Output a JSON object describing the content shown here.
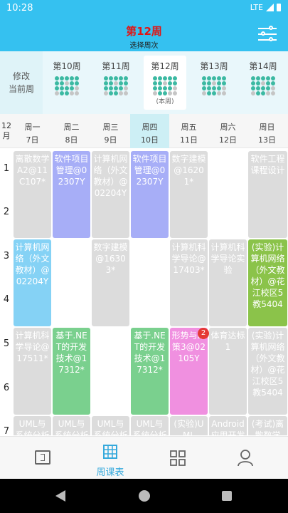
{
  "status": {
    "time": "10:28",
    "network": "LTE"
  },
  "header": {
    "title": "第12周",
    "subtitle": "选择周次"
  },
  "weeks": {
    "modify_label_1": "修改",
    "modify_label_2": "当前周",
    "items": [
      {
        "label": "第10周",
        "note": ""
      },
      {
        "label": "第11周",
        "note": ""
      },
      {
        "label": "第12周",
        "note": "(本周)"
      },
      {
        "label": "第13周",
        "note": ""
      },
      {
        "label": "第14周",
        "note": ""
      }
    ]
  },
  "calendar": {
    "month_num": "12",
    "month_unit": "月",
    "days": [
      {
        "name": "周一",
        "date": "7日"
      },
      {
        "name": "周二",
        "date": "8日"
      },
      {
        "name": "周三",
        "date": "9日"
      },
      {
        "name": "周四",
        "date": "10日"
      },
      {
        "name": "周五",
        "date": "11日"
      },
      {
        "name": "周六",
        "date": "12日"
      },
      {
        "name": "周日",
        "date": "13日"
      }
    ],
    "periods": [
      "1",
      "2",
      "3",
      "4",
      "5",
      "6",
      "7"
    ],
    "courses": [
      "离散数学A2@11C107*",
      "软件项目管理@02307Y",
      "计算机网络（外文教材）@02204Y",
      "软件项目管理@02307Y",
      "数字建模@16201*",
      "软件工程课程设计",
      "计算机网络（外文教材）@02204Y",
      "数字建模@16303*",
      "计算机科学导论@17403*",
      "计算机科学导论实验",
      "(实验)计算机网络（外文教材）@花江校区5教5404",
      "计算机科学导论@17511*",
      "基于.NET的开发技术@17312*",
      "基于.NET的开发技术@17312*",
      "形势与政策3@02105Y",
      "体育达标1",
      "(实验)计算机网络（外文教材）@花江校区5教5404",
      "UML与系统分析设计",
      "UML与系统分析设计",
      "UML与系统分析设计",
      "UML与系统分析设计",
      "(实验)UML",
      "Android应用开发",
      "(考试)离散数学"
    ],
    "badge": "2"
  },
  "tabs": {
    "schedule": "周课表"
  },
  "colors": {
    "accent": "#35c1f0",
    "title_red": "#e01515"
  }
}
